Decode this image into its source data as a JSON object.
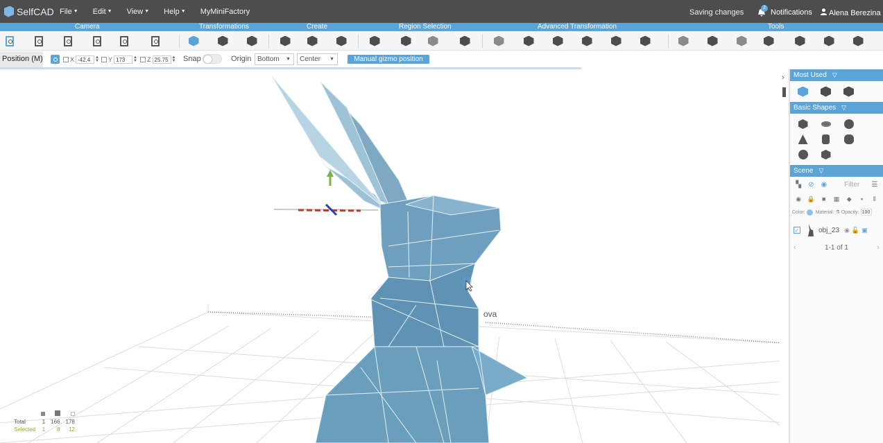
{
  "app": {
    "name": "SelfCAD"
  },
  "menu": [
    {
      "label": "File"
    },
    {
      "label": "Edit"
    },
    {
      "label": "View"
    },
    {
      "label": "Help"
    },
    {
      "label": "MyMiniFactory"
    }
  ],
  "status": {
    "saving": "Saving changes",
    "notifications_label": "Notifications",
    "notifications_count": "2"
  },
  "user": {
    "name": "Alena Berezina"
  },
  "categories": [
    "Camera",
    "Transformations",
    "Create",
    "Region Selection",
    "Advanced Transformation",
    "Tools"
  ],
  "toolbar_icons": [
    "paste-icon",
    "zoom-fit-icon",
    "import-icon",
    "snapshot-icon",
    "camera-settings-icon",
    "clipboard-icon",
    "move-icon",
    "rotate-icon",
    "scale-icon",
    "cube-create-icon",
    "extrude-icon",
    "sketch-icon",
    "select-region-icon",
    "face-select-icon",
    "edge-select-icon",
    "vertex-select-icon",
    "stitch-icon",
    "mesh-icon",
    "bevel-icon",
    "cone-icon",
    "twist-icon",
    "bend-icon",
    "boolean-icon",
    "solidify-icon",
    "hollow-icon",
    "sphere-tool-icon",
    "sculpt-icon",
    "slice-icon",
    "repair-icon"
  ],
  "options": {
    "mode": "Position (M)",
    "x_label": "X",
    "x": "-42.4",
    "y_label": "Y",
    "y": "173",
    "z_label": "Z",
    "z": "25.75",
    "snap_label": "Snap",
    "origin_label": "Origin",
    "origin_vertical": "Bottom",
    "origin_horizontal": "Center",
    "manual_gizmo": "Manual gizmo position"
  },
  "progress": 0.74,
  "stats": {
    "total_label": "Total",
    "selected_label": "Selected",
    "total": [
      "1",
      "166",
      "178"
    ],
    "selected": [
      "1",
      "8",
      "12"
    ]
  },
  "panel": {
    "most_used": {
      "title": "Most Used",
      "items": [
        "move-icon",
        "extrude-icon",
        "stitch-icon"
      ]
    },
    "basic_shapes": {
      "title": "Basic Shapes",
      "items": [
        "cube-icon",
        "torus-icon",
        "sphere-icon",
        "cone-icon",
        "cylinder-icon",
        "knot-icon",
        "gear-sphere-icon",
        "polyhedron-icon"
      ]
    },
    "scene": {
      "title": "Scene",
      "filter_placeholder": "Filter",
      "color_label": "Color:",
      "material_label": "Material:",
      "opacity_label": "Opacity:",
      "opacity": "100",
      "objects": [
        {
          "name": "obj_23"
        }
      ],
      "pager": "1-1 of 1"
    }
  },
  "colors": {
    "accent": "#5ba4d8",
    "topbar": "#4d4d4d",
    "model": "#6e9fbe",
    "selected_stat": "#8cae2a"
  }
}
